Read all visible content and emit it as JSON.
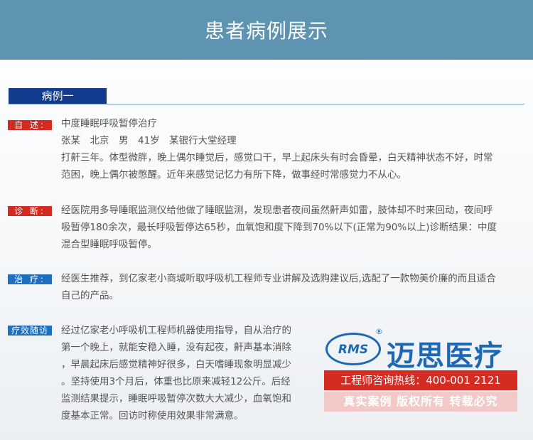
{
  "header": {
    "title": "患者病例展示"
  },
  "case_tab": "病例一",
  "sections": {
    "history": {
      "label": "自 述:",
      "lines": [
        "中度睡眠呼吸暂停治疗",
        "张某　北京　男　41岁　某银行大堂经理",
        "打鼾三年。体型微胖，晚上偶尔睡觉后，感觉口干，早上起床头有时会昏晕，白天精神状态不好，时常",
        "范困，晚上偶尔被憋醒。近年来感觉记忆力有所下降，做事经时常感觉力不从心。"
      ]
    },
    "diagnosis": {
      "label": "诊 断:",
      "lines": [
        "经医院用多导睡眠监测仪给他做了睡眠监测，发现患者夜间虽然鼾声如雷，肢体却不时来回动，夜间呼",
        "吸暂停180余次，最长呼吸暂停达65秒，血氧饱和度下降到70%以下(正常为90%以上)诊断结果：中度",
        "混合型睡眠呼吸暂停。"
      ]
    },
    "treatment": {
      "label": "治 疗:",
      "lines": [
        "经医生推荐，到亿家老小商城听取呼吸机工程师专业讲解及选购建议后,选配了一款物美价廉的而且适合",
        "自己的产品。"
      ]
    },
    "followup": {
      "label": "疗效随访",
      "lines": [
        "经过亿家老小呼吸机工程师机器使用指导，自从治疗的",
        "第一个晚上，就能安稳入睡，没有起夜，鼾声基本消除",
        "，早晨起床后感觉精神好很多，白天嗜睡现象明显减少",
        "。坚持使用3个月后，体重也比原来减轻12公斤。后经",
        "监测结果提示，睡眠呼吸暂停次数大大减少，血氧饱和",
        "度基本正常。回访时称使用效果非常满意。"
      ]
    }
  },
  "brand": {
    "logo_abbr": "RMS",
    "registered": "®",
    "name": "迈思医疗",
    "hotline": "工程师咨询热线：400-001 2121",
    "notice": "真实案例 版权所有 转载必究"
  },
  "colors": {
    "header": "#5e93b2",
    "tab": "#123b8e",
    "label_red": "#d32b22",
    "label_blue": "#1e6fc0",
    "brand_blue": "#1e67b5",
    "hotline_red": "#d42b23",
    "notice_pink": "#f2c9c6"
  }
}
